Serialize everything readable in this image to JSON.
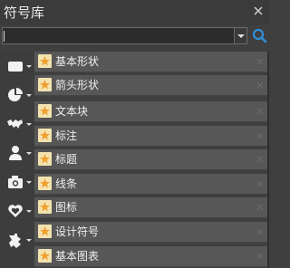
{
  "panel": {
    "title": "符号库",
    "close_icon": "close-icon"
  },
  "search": {
    "value": "",
    "placeholder": "",
    "dropdown_icon": "chevron-down-icon",
    "search_icon": "search-icon"
  },
  "sidebar": {
    "items": [
      {
        "icon": "rectangle-icon"
      },
      {
        "icon": "pie-chart-icon"
      },
      {
        "icon": "map-icon"
      },
      {
        "icon": "person-icon"
      },
      {
        "icon": "camera-icon"
      },
      {
        "icon": "heart-icon"
      },
      {
        "icon": "puzzle-icon"
      }
    ]
  },
  "categories": [
    {
      "label": "基本形状"
    },
    {
      "label": "箭头形状"
    },
    {
      "label": "文本块"
    },
    {
      "label": "标注"
    },
    {
      "label": "标题"
    },
    {
      "label": "线条"
    },
    {
      "label": "图标"
    },
    {
      "label": "设计符号"
    },
    {
      "label": "基本图表"
    }
  ],
  "colors": {
    "background": "#3f3f3f",
    "row": "#575757",
    "accent_blue": "#2f8fd8",
    "star_orange": "#f0a030"
  }
}
